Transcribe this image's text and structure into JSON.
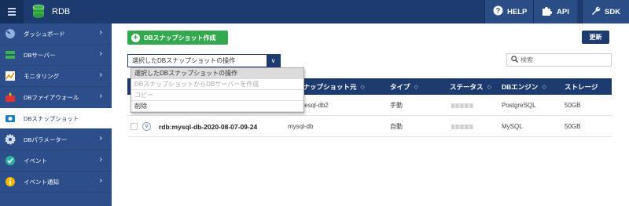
{
  "header": {
    "title": "RDB",
    "buttons": [
      {
        "label": "HELP",
        "icon": "help-icon"
      },
      {
        "label": "API",
        "icon": "puzzle-icon"
      },
      {
        "label": "SDK",
        "icon": "wrench-icon"
      }
    ]
  },
  "sidebar": {
    "items": [
      {
        "label": "ダッシュボード",
        "icon": "dashboard-icon",
        "active": false
      },
      {
        "label": "DBサーバー",
        "icon": "server-icon",
        "active": false
      },
      {
        "label": "モニタリング",
        "icon": "monitoring-icon",
        "active": false
      },
      {
        "label": "DBファイアウォール",
        "icon": "firewall-icon",
        "active": false
      },
      {
        "label": "DBスナップショット",
        "icon": "camera-icon",
        "active": true
      },
      {
        "label": "DBパラメーター",
        "icon": "gear-icon",
        "active": false
      },
      {
        "label": "イベント",
        "icon": "check-icon",
        "active": false
      },
      {
        "label": "イベント通知",
        "icon": "info-icon",
        "active": false
      }
    ]
  },
  "toolbar": {
    "create_label": "DBスナップショット作成",
    "refresh_label": "更新",
    "search_placeholder": "検索"
  },
  "action_select": {
    "value": "選択したDBスナップショットの操作",
    "options": [
      {
        "label": "選択したDBスナップショットの操作",
        "state": "selected"
      },
      {
        "label": "DBスナップショットからDBサーバーを作成",
        "state": "disabled"
      },
      {
        "label": "コピー",
        "state": "disabled"
      },
      {
        "label": "削除",
        "state": "enabled"
      }
    ]
  },
  "table": {
    "columns": [
      "スナップショット元",
      "タイプ",
      "ステータス",
      "DBエンジン",
      "ストレージ"
    ],
    "rows": [
      {
        "name": "",
        "source": "gresql-db2",
        "type": "手動",
        "status": "",
        "engine": "PostgreSQL",
        "storage": "50GB"
      },
      {
        "name": "rdb:mysql-db-2020-08-07-09-24",
        "source": "mysql-db",
        "type": "自動",
        "status": "",
        "engine": "MySQL",
        "storage": "50GB"
      }
    ]
  },
  "colors": {
    "topbar": "#1d3b6e",
    "sidebar": "#2c4e8a",
    "create_button": "#33a84e",
    "table_header": "#1d3b6e"
  }
}
